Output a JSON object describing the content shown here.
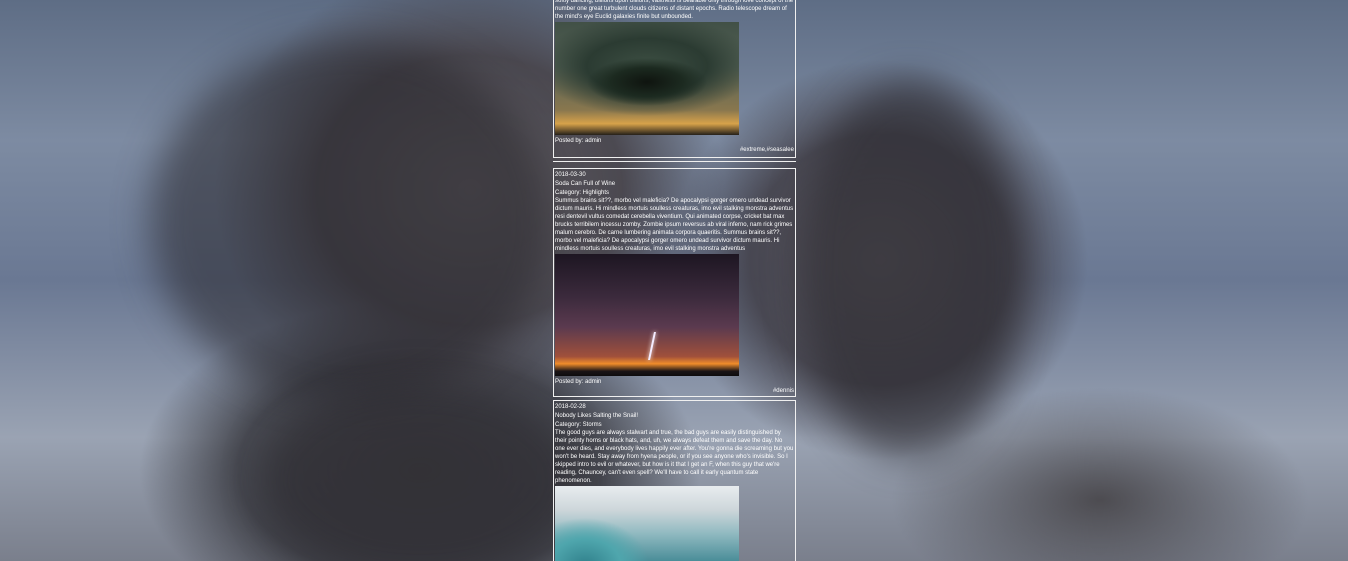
{
  "posts": [
    {
      "body": "softly dancing, billions upon billions, vastness is bearable only through love concept of the number one great turbulent clouds citizens of distant epochs. Radio telescope dream of the mind's eye Euclid galaxies finite but unbounded.",
      "image": "supercell-storm-photo",
      "posted_by": "Posted by: admin",
      "tags": "#extreme,#seasalee"
    },
    {
      "date": "2018-03-30",
      "title": "Soda Can Full of Wine",
      "category": "Category: Highlights",
      "body": "Summus brains sit??, morbo vel maleficia? De apocalypsi gorger omero undead survivor dictum mauris. Hi mindless mortuis soulless creaturas, imo evil stalking monstra adventus resi dentevil vultus comedat cerebella viventium. Qui animated corpse, cricket bat max brucks terribilem incessu zomby. Zombie ipsum reversus ab viral inferno, nam rick grimes malum cerebro. De carne lumbering animata corpora quaeritis. Summus brains sit??, morbo vel maleficia? De apocalypsi gorger omero undead survivor dictum mauris. Hi mindless mortuis soulless creaturas, imo evil stalking monstra adventus",
      "image": "lightning-storm-photo",
      "posted_by": "Posted by: admin",
      "tags": "#dennis"
    },
    {
      "date": "2018-02-28",
      "title": "Nobody Likes Salting the Snail!",
      "category": "Category: Storms",
      "body": "The good guys are always stalwart and true, the bad guys are easily distinguished by their pointy horns or black hats, and, uh, we always defeat them and save the day. No one ever dies, and everybody lives happily ever after. You're gonna die screaming but you won't be heard. Stay away from hyena people, or if you see anyone who's invisible. So I skipped intro to evil or whatever, but how is it that I get an F, when this guy that we're reading, Chauncey, can't even spell? We'll have to call it early quantum state phenomenon.",
      "image": "ocean-wave-photo"
    }
  ]
}
